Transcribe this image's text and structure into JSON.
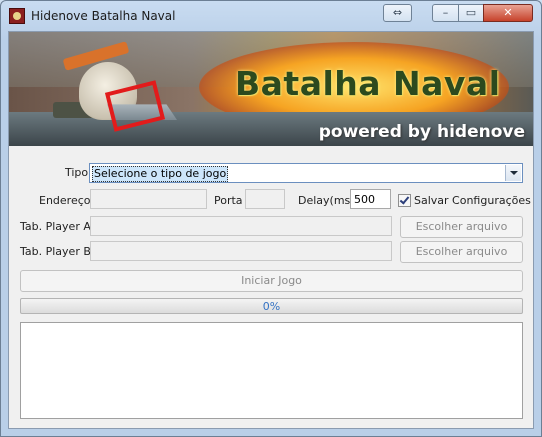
{
  "window": {
    "title": "Hidenove Batalha Naval",
    "swap_symbol": "⇔",
    "min_symbol": "–",
    "max_symbol": "▭",
    "close_symbol": "✕"
  },
  "banner": {
    "title": "Batalha Naval",
    "subtitle": "powered by hidenove"
  },
  "form": {
    "tipo_label": "Tipo",
    "tipo_selected": "Selecione o tipo de jogo",
    "endereco_label": "Endereço",
    "endereco_value": "",
    "porta_label": "Porta",
    "porta_value": "",
    "delay_label": "Delay(ms)",
    "delay_value": "500",
    "salvar_label": "Salvar Configurações",
    "salvar_checked": true,
    "player_a_label": "Tab. Player A",
    "player_a_value": "",
    "player_b_label": "Tab. Player B",
    "player_b_value": "",
    "escolher_label": "Escolher arquivo"
  },
  "actions": {
    "iniciar_label": "Iniciar Jogo"
  },
  "progress": {
    "value": 0,
    "text": "0%"
  },
  "log": {
    "text": ""
  },
  "colors": {
    "accent": "#3b8be0",
    "title_bar": "#c9dcf1",
    "close_button": "#c7422b"
  },
  "icons": [
    "app-icon",
    "window-swap-icon",
    "checkbox-check-icon",
    "dropdown-arrow-icon"
  ]
}
